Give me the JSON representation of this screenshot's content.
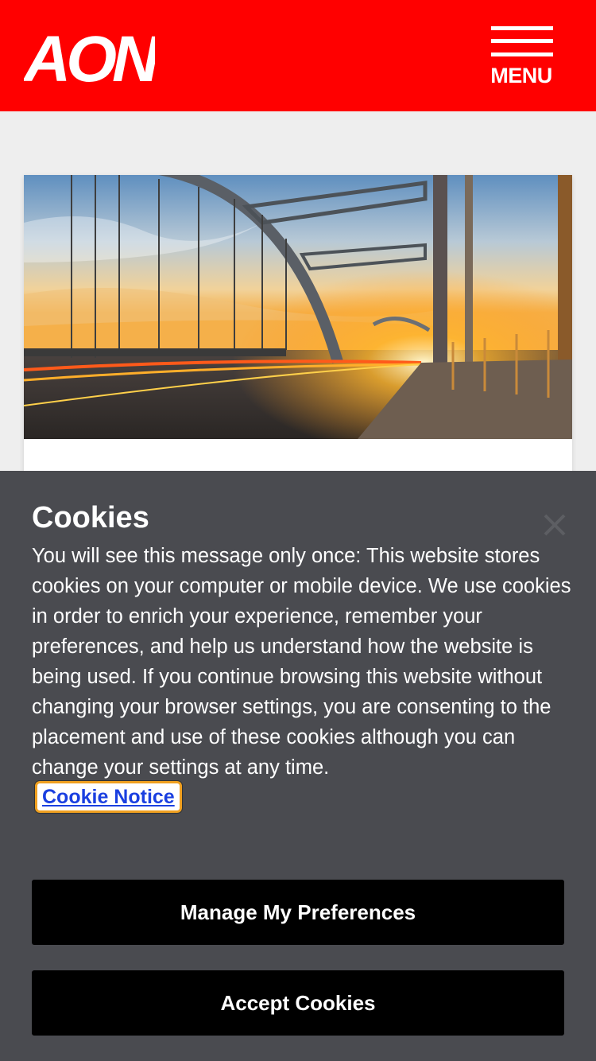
{
  "header": {
    "logo_text": "AON",
    "menu_label": "MENU",
    "brand_color": "#ff0000"
  },
  "hero": {
    "image": "bridge-sunset-photo"
  },
  "cookie_banner": {
    "title": "Cookies",
    "body": "You will see this message only once: This website stores cookies on your computer or mobile device. We use cookies in order to enrich your experience, remember your preferences, and help us understand how the website is being used. If you continue browsing this website without changing your browser settings, you are consenting to the placement and use of these cookies although you can change your settings at any time.",
    "link_label": "Cookie Notice",
    "close_icon": "close-icon",
    "manage_label": "Manage My Preferences",
    "accept_label": "Accept Cookies",
    "panel_color": "#4a4b50"
  }
}
